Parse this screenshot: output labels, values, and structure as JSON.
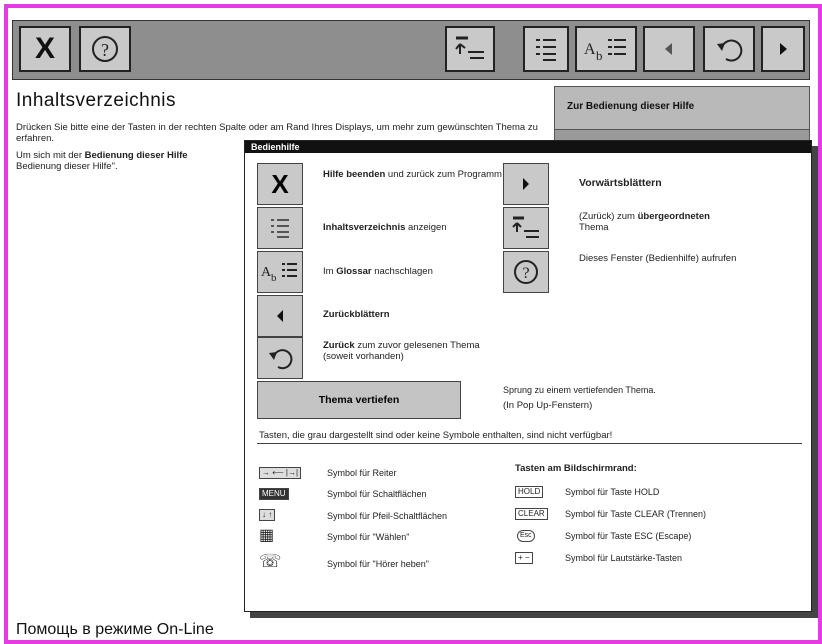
{
  "toolbar": {
    "close_icon": "X",
    "help_icon": "?"
  },
  "main": {
    "title": "Inhaltsverzeichnis",
    "intro_1": "Drücken Sie bitte eine der Tasten in der rechten Spalte oder am Rand Ihres Displays, um mehr zum gewünschten Thema zu erfahren.",
    "intro_2a": "Um sich mit der ",
    "intro_2b": "Bedienung dieser Hilfe",
    "intro_2c": " Bedienung dieser Hilfe\"."
  },
  "right_panel": {
    "label": "Zur Bedienung dieser Hilfe"
  },
  "popup": {
    "header": "Bedienhilfe",
    "items_left": [
      {
        "bold": "Hilfe beenden",
        "rest": " und zurück zum Programm"
      },
      {
        "bold": "Inhaltsverzeichnis",
        "rest": " anzeigen"
      },
      {
        "pre": "Im ",
        "bold": "Glossar",
        "rest": " nachschlagen"
      },
      {
        "bold": "Zurückblättern",
        "rest": ""
      },
      {
        "bold": "Zurück",
        "rest": " zum zuvor gelesenen Thema (soweit vorhanden)"
      }
    ],
    "items_right": [
      {
        "bold": "Vorwärtsblättern",
        "rest": ""
      },
      {
        "pre": "(Zurück) zum ",
        "bold": "übergeordneten",
        "rest": " Thema"
      },
      {
        "pre": "Dieses Fenster (Bedienhilfe) aufrufen",
        "bold": "",
        "rest": ""
      }
    ],
    "big_button": "Thema vertiefen",
    "big_button_desc_1": "Sprung zu einem vertiefenden Thema.",
    "big_button_desc_2": "(In Pop Up-Fenstern)",
    "note": "Tasten, die grau dargestellt sind oder keine Symbole enthalten, sind nicht verfügbar!",
    "legend_left": [
      {
        "sym": "→ ⟵ |→|",
        "text": "Symbol für Reiter"
      },
      {
        "sym": "MENU",
        "text": "Symbol für Schaltflächen"
      },
      {
        "sym": "↓ ↑",
        "text": "Symbol für Pfeil-Schaltflächen"
      },
      {
        "sym": "▦",
        "text": "Symbol für \"Wählen\""
      },
      {
        "sym": "☏",
        "text": "Symbol für \"Hörer heben\""
      }
    ],
    "legend_right_title": "Tasten am Bildschirmrand:",
    "legend_right": [
      {
        "sym": "HOLD",
        "text": "Symbol für Taste HOLD"
      },
      {
        "sym": "CLEAR",
        "text": "Symbol für Taste CLEAR (Trennen)"
      },
      {
        "sym": "Esc",
        "text": "Symbol für Taste ESC (Escape)"
      },
      {
        "sym": "+ −",
        "text": "Symbol für Lautstärke-Tasten"
      }
    ]
  },
  "caption": "Помощь в режиме On-Line"
}
